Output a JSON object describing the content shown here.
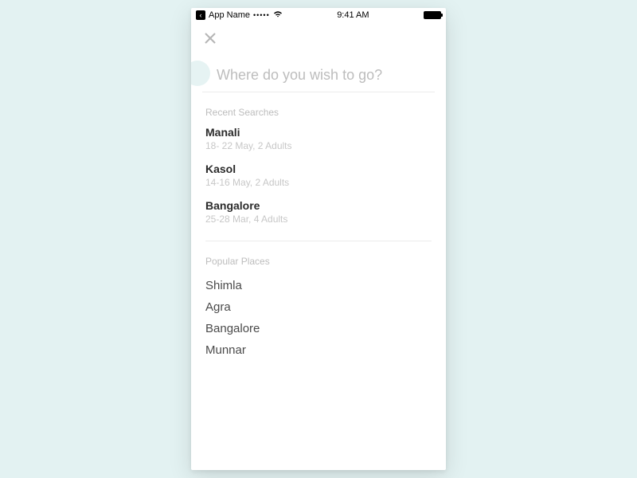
{
  "statusbar": {
    "appName": "App Name",
    "time": "9:41 AM"
  },
  "search": {
    "placeholder": "Where do you wish to go?"
  },
  "sections": {
    "recentLabel": "Recent Searches",
    "popularLabel": "Popular Places"
  },
  "recent": [
    {
      "name": "Manali",
      "detail": "18- 22 May, 2 Adults"
    },
    {
      "name": "Kasol",
      "detail": "14-16 May, 2 Adults"
    },
    {
      "name": "Bangalore",
      "detail": "25-28 Mar, 4 Adults"
    }
  ],
  "popular": [
    "Shimla",
    "Agra",
    "Bangalore",
    "Munnar"
  ]
}
